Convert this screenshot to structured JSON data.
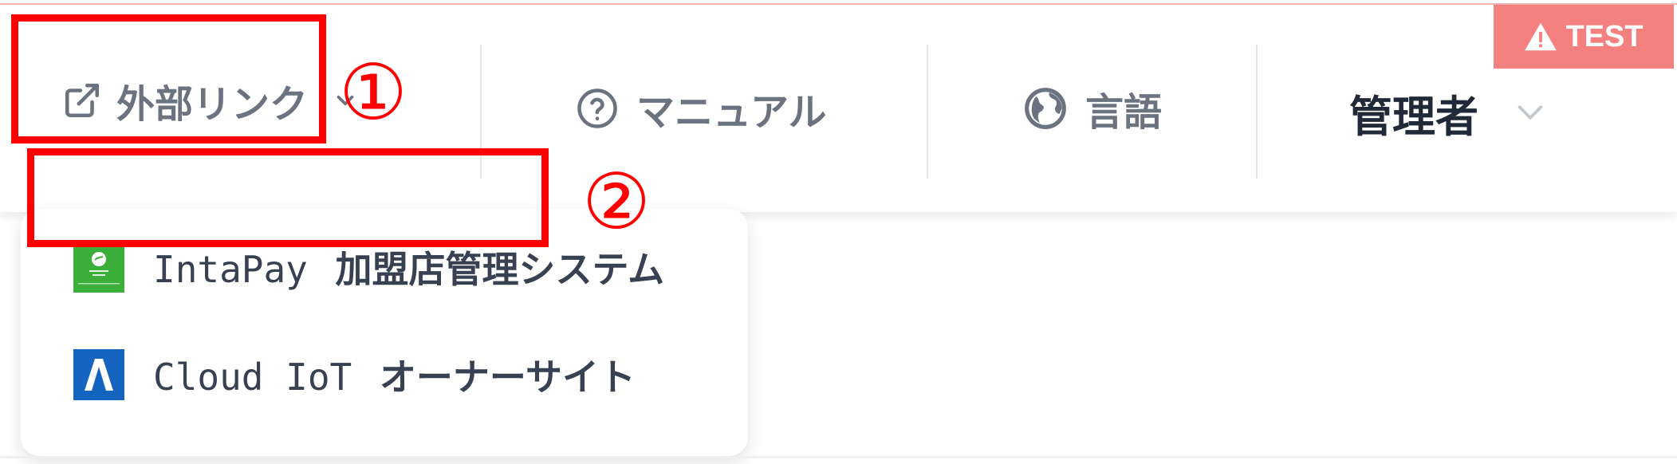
{
  "header": {
    "external_links": {
      "label": "外部リンク",
      "icon": "external-link-icon",
      "chevron": "chevron-down-icon"
    },
    "manual": {
      "label": "マニュアル",
      "icon": "question-circle-icon"
    },
    "language": {
      "label": "言語",
      "icon": "globe-icon"
    },
    "user": {
      "label": "管理者",
      "chevron": "chevron-down-icon"
    },
    "env_badge": {
      "label": "TEST",
      "icon": "warning-icon",
      "color": "#f48080"
    }
  },
  "dropdown": {
    "items": [
      {
        "label_latin": "IntaPay",
        "label_jp": "加盟店管理システム",
        "icon": "intapay-logo-icon",
        "color": "#3cae3a"
      },
      {
        "label_latin": "Cloud IoT",
        "label_jp": "オーナーサイト",
        "icon": "cloud-iot-logo-icon",
        "color": "#1565c0"
      }
    ]
  },
  "annotations": {
    "marker_1": "①",
    "marker_2": "②",
    "highlight_color": "#ff0000"
  }
}
